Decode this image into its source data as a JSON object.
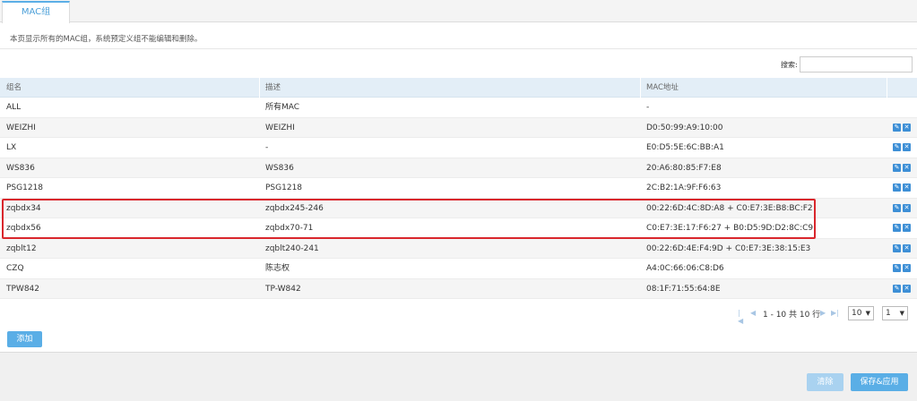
{
  "tab": {
    "label": "MAC组"
  },
  "description": "本页显示所有的MAC组，系统预定义组不能编辑和删除。",
  "search": {
    "label": "搜索:",
    "value": "",
    "placeholder": ""
  },
  "table": {
    "headers": {
      "name": "组名",
      "desc": "描述",
      "mac": "MAC地址"
    },
    "rows": [
      {
        "name": "ALL",
        "desc": "所有MAC",
        "mac": "-",
        "editable": false
      },
      {
        "name": "WEIZHI",
        "desc": "WEIZHI",
        "mac": "D0:50:99:A9:10:00",
        "editable": true
      },
      {
        "name": "LX",
        "desc": "-",
        "mac": "E0:D5:5E:6C:BB:A1",
        "editable": true
      },
      {
        "name": "WS836",
        "desc": "WS836",
        "mac": "20:A6:80:85:F7:E8",
        "editable": true
      },
      {
        "name": "PSG1218",
        "desc": "PSG1218",
        "mac": "2C:B2:1A:9F:F6:63",
        "editable": true
      },
      {
        "name": "zqbdx34",
        "desc": "zqbdx245-246",
        "mac": "00:22:6D:4C:8D:A8 + C0:E7:3E:B8:BC:F2",
        "editable": true
      },
      {
        "name": "zqbdx56",
        "desc": "zqbdx70-71",
        "mac": "C0:E7:3E:17:F6:27 + B0:D5:9D:D2:8C:C9",
        "editable": true
      },
      {
        "name": "zqblt12",
        "desc": "zqblt240-241",
        "mac": "00:22:6D:4E:F4:9D + C0:E7:3E:38:15:E3",
        "editable": true
      },
      {
        "name": "CZQ",
        "desc": "陈志权",
        "mac": "A4:0C:66:06:C8:D6",
        "editable": true
      },
      {
        "name": "TPW842",
        "desc": "TP-W842",
        "mac": "08:1F:71:55:64:8E",
        "editable": true
      }
    ]
  },
  "pagination": {
    "summary": "1 - 10 共 10 行",
    "page_size": "10",
    "page": "1"
  },
  "buttons": {
    "add": "添加",
    "clear": "清除",
    "save": "保存&应用"
  },
  "colors": {
    "accent": "#5aaee6",
    "highlight": "#d9262c",
    "header_bg": "#e3eef7"
  }
}
